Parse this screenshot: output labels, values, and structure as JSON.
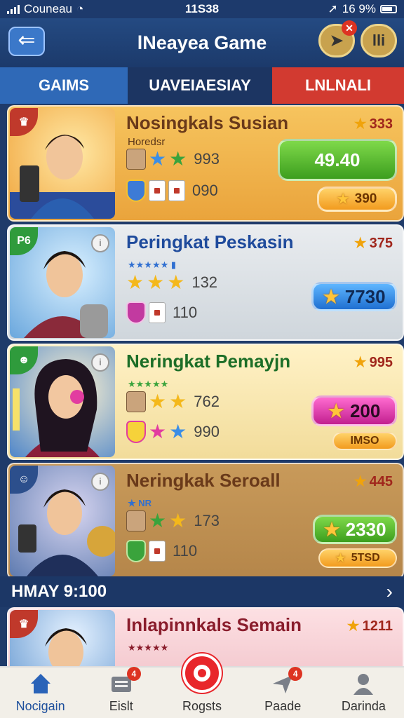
{
  "status_bar": {
    "carrier": "Couneau",
    "time": "11S38",
    "battery": "16 9%"
  },
  "header": {
    "back_glyph": "⇐",
    "title": "lNeayea Game",
    "btn2_label": "lli"
  },
  "tabs": [
    "GAIMS",
    "UAVEIAESIAY",
    "LNLNALI"
  ],
  "cards": [
    {
      "title": "Nosingkals Susian",
      "subtitle": "Horedsr",
      "score": "333",
      "row1_value": "993",
      "row2_value": "090",
      "primary_button": "49.40",
      "secondary_button": "390"
    },
    {
      "title": "Peringkat Peskasin",
      "corner": "P6",
      "score": "375",
      "row1_value": "132",
      "row2_value": "110",
      "primary_button": "7730"
    },
    {
      "title": "Neringkat Pemayjn",
      "score": "995",
      "row1_value": "762",
      "row2_value": "990",
      "primary_button": "200",
      "secondary_button": "IMSO"
    },
    {
      "title": "Neringkak Seroall",
      "subtitle": "NR",
      "score": "445",
      "row1_value": "173",
      "row2_value": "110",
      "primary_button": "2330",
      "secondary_button": "5TSD"
    },
    {
      "title": "Inlapinnkals Semain",
      "score": "1211"
    }
  ],
  "section": {
    "title": "HMAY 9:100"
  },
  "bottom_nav": [
    {
      "label": "Nocigain"
    },
    {
      "label": "Eislt",
      "badge": "4"
    },
    {
      "label": "Rogsts"
    },
    {
      "label": "Paade",
      "badge": "4"
    },
    {
      "label": "Darinda"
    }
  ]
}
